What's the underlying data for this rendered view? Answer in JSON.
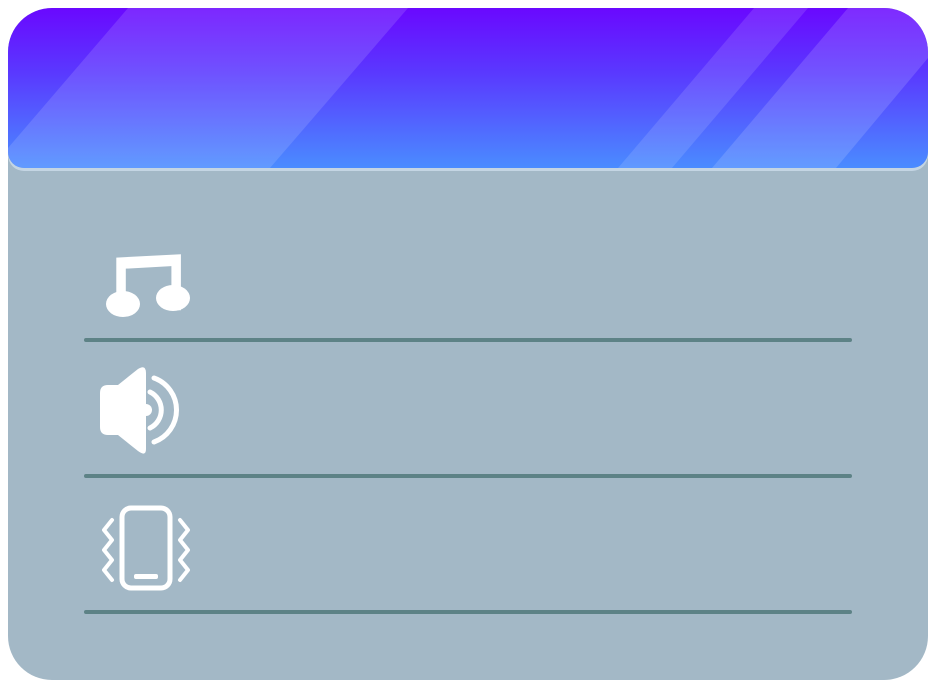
{
  "colors": {
    "header_top": "#6a08ff",
    "header_bottom": "#4a8cff",
    "panel_bg": "#a3b8c6",
    "divider": "#5d8286",
    "icon": "#ffffff"
  },
  "settings": {
    "rows": [
      {
        "icon": "music-note-icon",
        "label": ""
      },
      {
        "icon": "speaker-volume-icon",
        "label": ""
      },
      {
        "icon": "phone-vibrate-icon",
        "label": ""
      }
    ]
  }
}
